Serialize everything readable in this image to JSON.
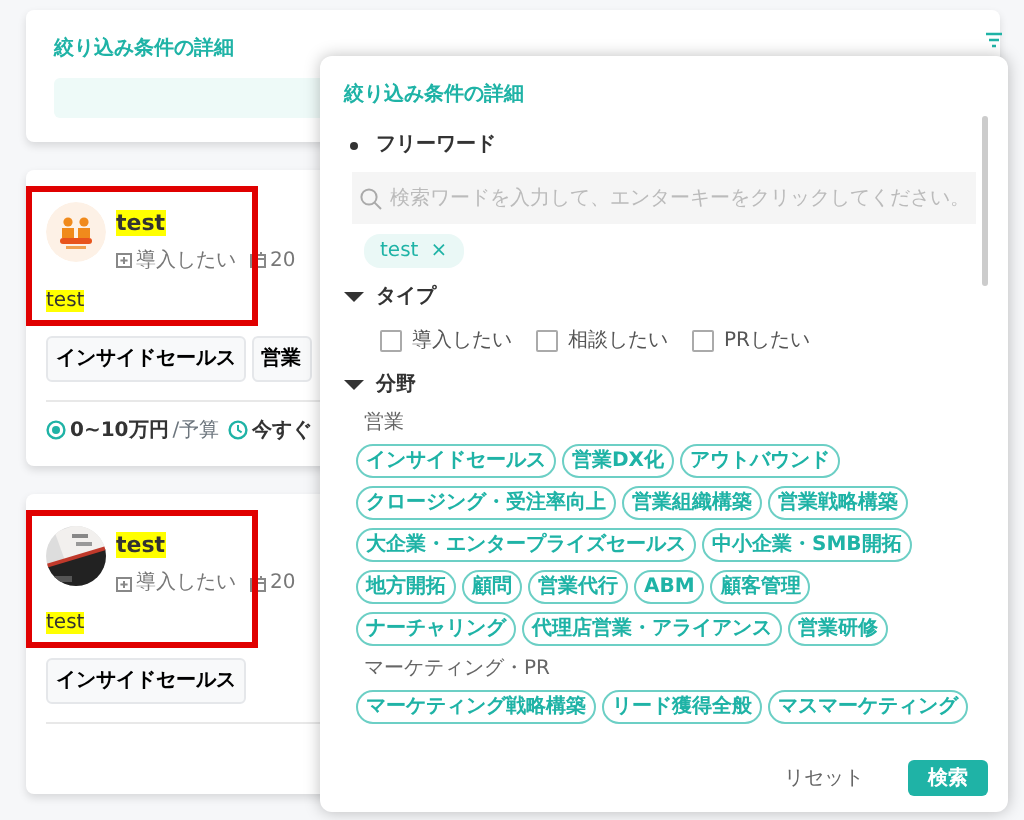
{
  "header_card": {
    "title": "絞り込み条件の詳細"
  },
  "results": [
    {
      "title": "test",
      "highlighted": true,
      "annotated": true,
      "type": "導入したい",
      "date": "20",
      "description": "test",
      "tags": [
        "インサイドセールス",
        "営業"
      ],
      "budget": "0~10万円",
      "budget_label": "/予算",
      "timing": "今すぐ"
    },
    {
      "title": "test",
      "highlighted": true,
      "annotated": true,
      "type": "導入したい",
      "date": "20",
      "description": "test",
      "tags": [
        "インサイドセールス"
      ]
    }
  ],
  "modal": {
    "title": "絞り込み条件の詳細",
    "sections": [
      {
        "kind": "freeword",
        "label": "フリーワード",
        "placeholder": "検索ワードを入力して、エンターキーをクリックしてください。",
        "chips": [
          {
            "label": "test",
            "remove": "×"
          }
        ]
      },
      {
        "kind": "checkboxes",
        "label": "タイプ",
        "expanded": true,
        "options": [
          {
            "label": "導入したい",
            "checked": false
          },
          {
            "label": "相談したい",
            "checked": false
          },
          {
            "label": "PRしたい",
            "checked": false
          }
        ]
      },
      {
        "kind": "tags",
        "label": "分野",
        "expanded": true,
        "groups": [
          {
            "label": "営業",
            "tags": [
              "インサイドセールス",
              "営業DX化",
              "アウトバウンド",
              "クロージング・受注率向上",
              "営業組織構築",
              "営業戦略構築",
              "大企業・エンタープライズセールス",
              "中小企業・SMB開拓",
              "地方開拓",
              "顧問",
              "営業代行",
              "ABM",
              "顧客管理",
              "ナーチャリング",
              "代理店営業・アライアンス",
              "営業研修"
            ]
          },
          {
            "label": "マーケティング・PR",
            "tags": [
              "マーケティング戦略構築",
              "リード獲得全般",
              "マスマーケティング"
            ]
          }
        ]
      }
    ],
    "buttons": [
      {
        "label": "リセット",
        "kind": "link"
      },
      {
        "label": "検索",
        "kind": "primary"
      }
    ]
  }
}
